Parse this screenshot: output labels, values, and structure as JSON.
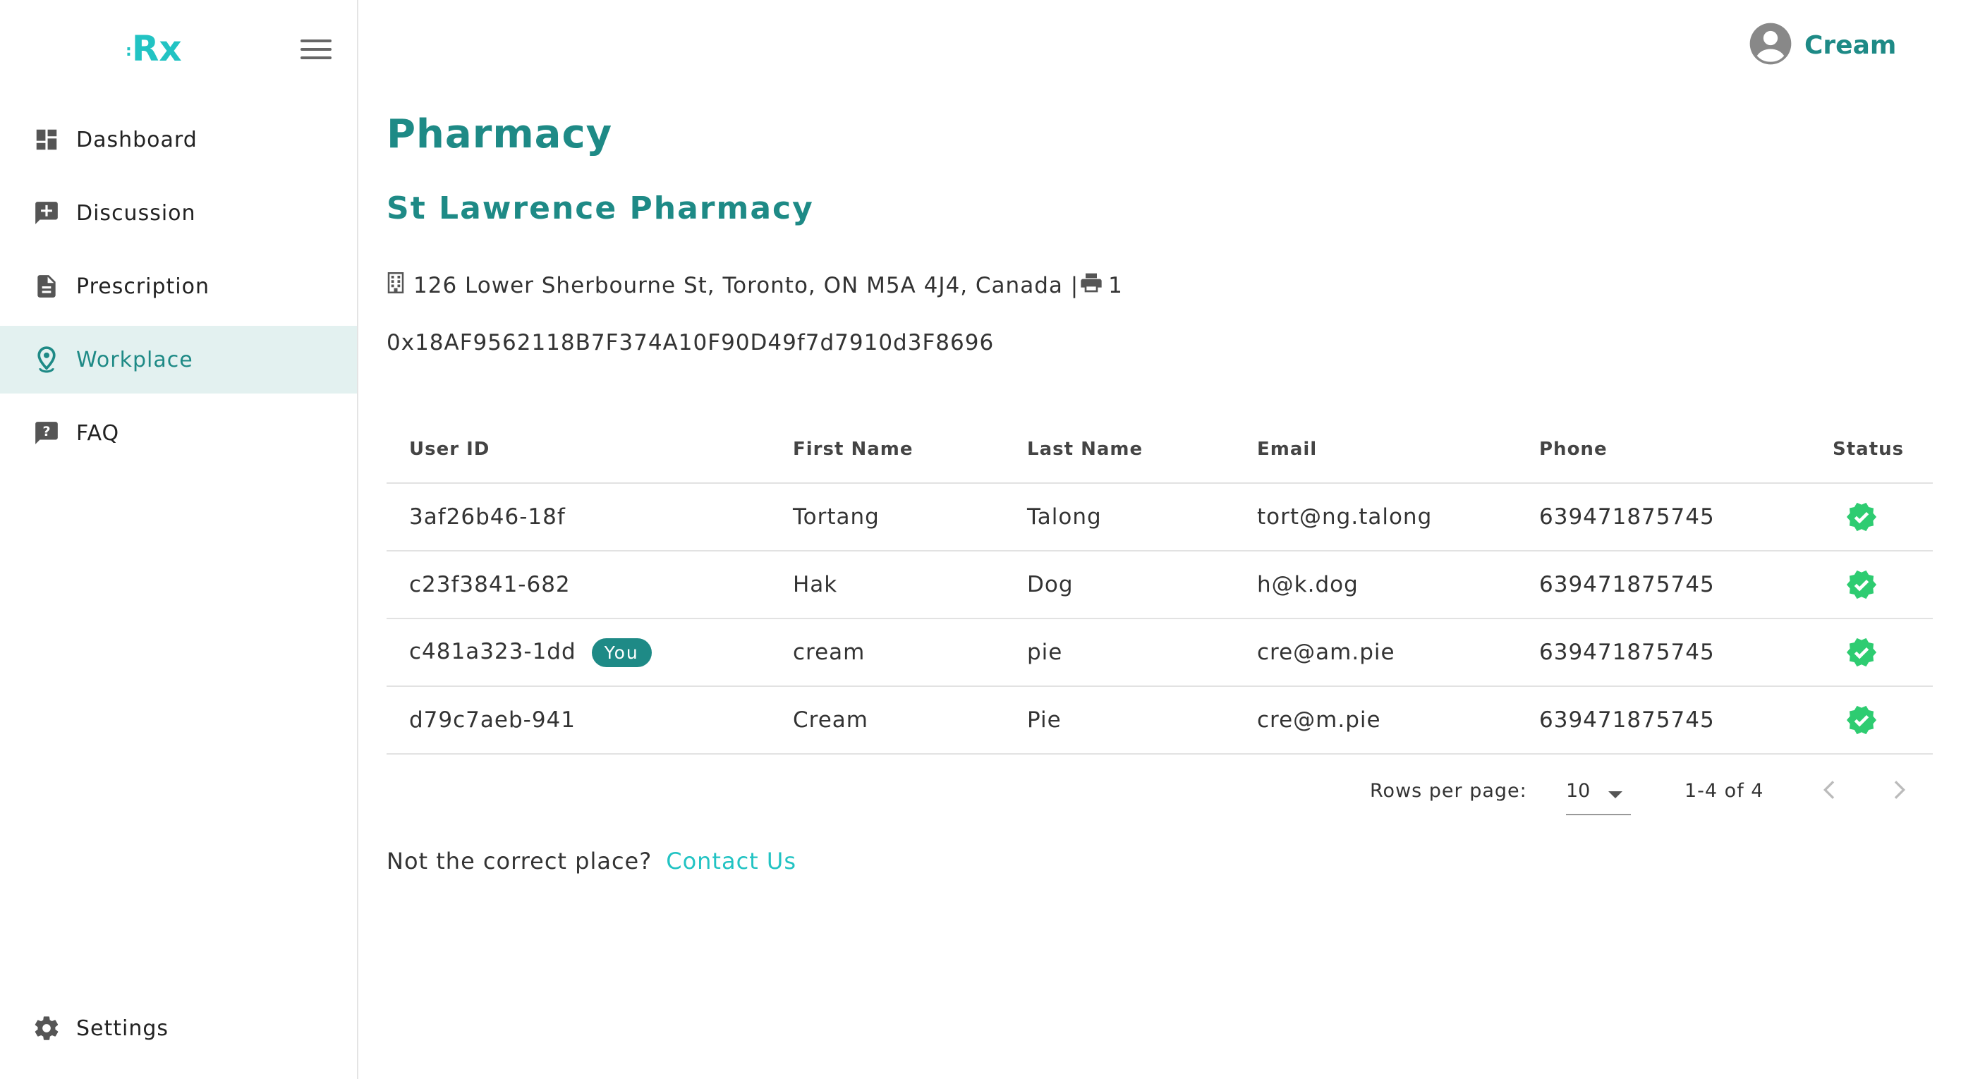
{
  "brand": {
    "logo_prefix": ":",
    "logo_text": "Rx"
  },
  "sidebar": {
    "items": [
      {
        "label": "Dashboard",
        "icon": "dashboard-icon",
        "active": false
      },
      {
        "label": "Discussion",
        "icon": "add-comment-icon",
        "active": false
      },
      {
        "label": "Prescription",
        "icon": "document-icon",
        "active": false
      },
      {
        "label": "Workplace",
        "icon": "location-pin-icon",
        "active": true
      },
      {
        "label": "FAQ",
        "icon": "question-comment-icon",
        "active": false
      }
    ],
    "settings_label": "Settings"
  },
  "header": {
    "user_name": "Cream"
  },
  "page": {
    "title": "Pharmacy",
    "pharmacy_name": "St Lawrence Pharmacy",
    "address": "126 Lower Sherbourne St, Toronto, ON M5A 4J4, Canada |",
    "fax": "1",
    "wallet": "0x18AF9562118B7F374A10F90D49f7d7910d3F8696"
  },
  "table": {
    "columns": [
      "User ID",
      "First Name",
      "Last Name",
      "Email",
      "Phone",
      "Status"
    ],
    "rows": [
      {
        "user_id": "3af26b46-18f",
        "first_name": "Tortang",
        "last_name": "Talong",
        "email": "tort@ng.talong",
        "phone": "639471875745",
        "status": "verified",
        "badge": ""
      },
      {
        "user_id": "c23f3841-682",
        "first_name": "Hak",
        "last_name": "Dog",
        "email": "h@k.dog",
        "phone": "639471875745",
        "status": "verified",
        "badge": ""
      },
      {
        "user_id": "c481a323-1dd",
        "first_name": "cream",
        "last_name": "pie",
        "email": "cre@am.pie",
        "phone": "639471875745",
        "status": "verified",
        "badge": "You"
      },
      {
        "user_id": "d79c7aeb-941",
        "first_name": "Cream",
        "last_name": "Pie",
        "email": "cre@m.pie",
        "phone": "639471875745",
        "status": "verified",
        "badge": ""
      }
    ]
  },
  "pagination": {
    "rows_per_page_label": "Rows per page:",
    "rows_per_page": "10",
    "range": "1-4 of 4"
  },
  "footer": {
    "question": "Not the correct place?",
    "link": "Contact Us"
  },
  "colors": {
    "accent": "#1e8a86",
    "link": "#22c3c3",
    "success": "#2ecc71",
    "active_bg": "#e3f1f0"
  }
}
